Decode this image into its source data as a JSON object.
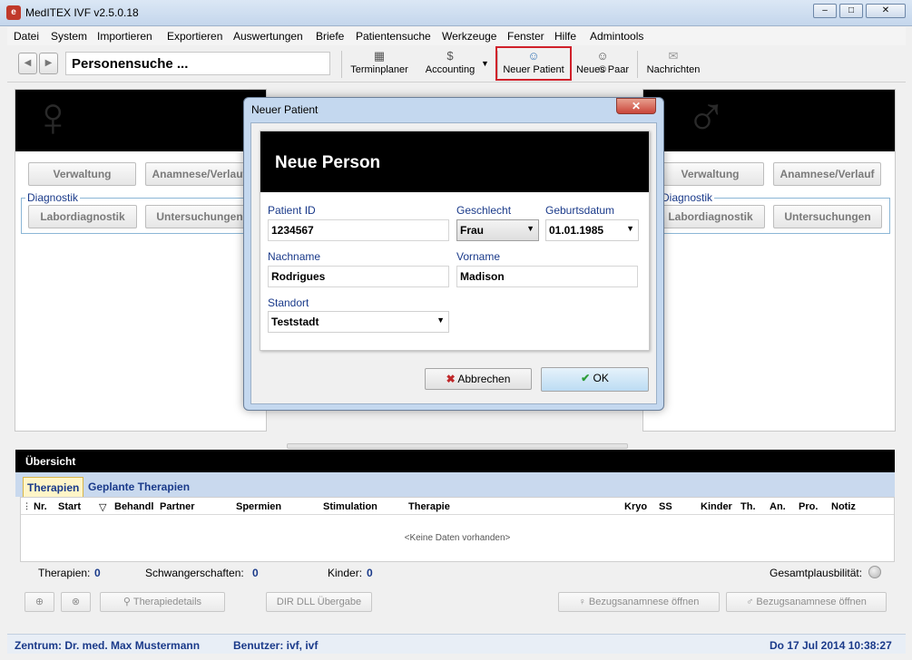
{
  "window": {
    "title": "MedITEX IVF v2.5.0.18",
    "app_icon": "meditex-logo-icon",
    "min": "–",
    "max": "□",
    "close": "✕"
  },
  "menu": [
    "Datei",
    "System",
    "Importieren",
    "Exportieren",
    "Auswertungen",
    "Briefe",
    "Patientensuche",
    "Werkzeuge",
    "Fenster",
    "Hilfe",
    "Admintools"
  ],
  "toolbar": {
    "back": "◀",
    "forward": "▶",
    "search_value": "Personensuche ...",
    "buttons": [
      {
        "label": "Terminplaner",
        "icon": "calendar-grid-icon",
        "glyph": "▦"
      },
      {
        "label": "Accounting",
        "icon": "money-bag-icon",
        "glyph": "$"
      },
      {
        "label": "Neuer Patient",
        "icon": "add-person-icon",
        "glyph": "☺"
      },
      {
        "label": "Neues Paar",
        "icon": "couple-icon",
        "glyph": "☺☺"
      },
      {
        "label": "Nachrichten",
        "icon": "envelope-icon",
        "glyph": "✉"
      }
    ],
    "accounting_dropdown": "▼"
  },
  "left_panel": {
    "icon": "female-symbol-icon",
    "glyph": "♀",
    "btn_verwaltung": "Verwaltung",
    "btn_anamnese": "Anamnese/Verlauf",
    "group_label": "Diagnostik",
    "btn_labor": "Labordiagnostik",
    "btn_untersuchungen": "Untersuchungen"
  },
  "right_panel": {
    "icon": "male-symbol-icon",
    "glyph": "♂",
    "btn_verwaltung": "Verwaltung",
    "btn_anamnese": "Anamnese/Verlauf",
    "group_label": "Diagnostik",
    "btn_labor": "Labordiagnostik",
    "btn_untersuchungen": "Untersuchungen"
  },
  "dialog": {
    "title": "Neuer Patient",
    "close": "✕",
    "header": "Neue Person",
    "patient_id_label": "Patient ID",
    "patient_id_value": "1234567",
    "geschlecht_label": "Geschlecht",
    "geschlecht_value": "Frau",
    "geburtsdatum_label": "Geburtsdatum",
    "geburtsdatum_value": "01.01.1985",
    "nachname_label": "Nachname",
    "nachname_value": "Rodrigues",
    "vorname_label": "Vorname",
    "vorname_value": "Madison",
    "standort_label": "Standort",
    "standort_value": "Teststadt",
    "cancel_label": "Abbrechen",
    "cancel_icon": "✖",
    "ok_label": "OK",
    "ok_icon": "✔",
    "arrow": "▼"
  },
  "overview": {
    "title": "Übersicht",
    "tabs": [
      "Therapien",
      "Geplante Therapien"
    ],
    "columns": [
      "Nr.",
      "Start",
      "Behandl",
      "Partner",
      "Spermien",
      "Stimulation",
      "Therapie",
      "Kryo",
      "SS",
      "Kinder",
      "Th.",
      "An.",
      "Pro.",
      "Notiz"
    ],
    "sort_icon": "▽",
    "empty_text": "<Keine Daten vorhanden>",
    "summary": {
      "therapien_label": "Therapien:",
      "therapien_value": "0",
      "schwangerschaften_label": "Schwangerschaften:",
      "schwangerschaften_value": "0",
      "kinder_label": "Kinder:",
      "kinder_value": "0",
      "plausi_label": "Gesamtplausbilität:"
    },
    "btn_therapiedetails": "Therapiedetails",
    "btn_dir_dll": "DIR DLL Übergabe",
    "btn_bezug_female": "Bezugsanamnese öffnen",
    "btn_bezug_male": "Bezugsanamnese öffnen"
  },
  "status": {
    "zentrum": "Zentrum: Dr. med. Max Mustermann",
    "benutzer": "Benutzer: ivf, ivf",
    "datetime": "Do 17 Jul 2014 10:38:27"
  },
  "colors": {
    "highlight": "#d0202a",
    "label_blue": "#1a3a8a",
    "ok_check": "#2e9d3a",
    "cancel_x": "#c0282a"
  }
}
